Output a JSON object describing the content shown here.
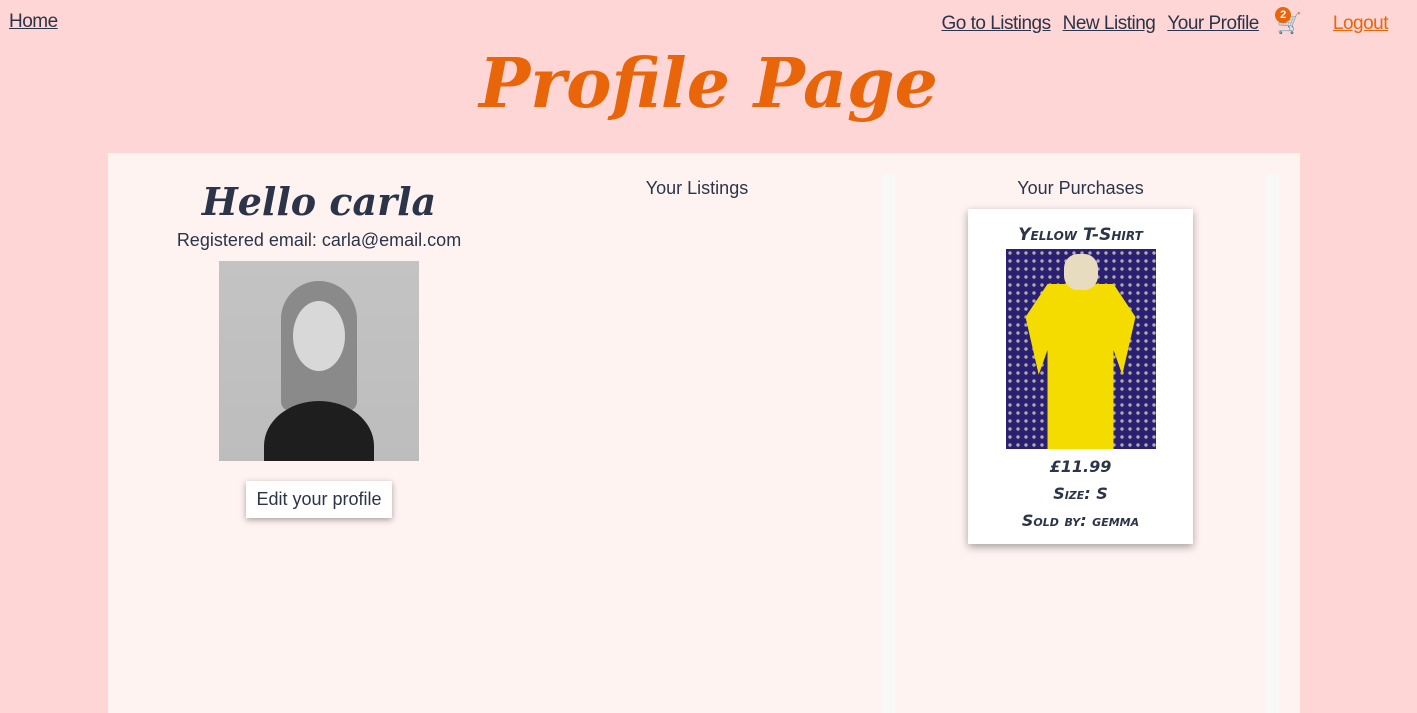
{
  "nav": {
    "home": "Home",
    "listings": "Go to Listings",
    "new_listing": "New Listing",
    "profile": "Your Profile",
    "cart_count": "2",
    "cart_icon": "shopping-cart-icon",
    "logout": "Logout"
  },
  "title": "Profile Page",
  "profile": {
    "greeting": "Hello carla",
    "email": "Registered email: carla@email.com",
    "edit_button": "Edit your profile"
  },
  "listings": {
    "heading": "Your Listings"
  },
  "purchases": {
    "heading": "Your Purchases",
    "items": [
      {
        "title": "Yellow T-Shirt",
        "price": "£11.99",
        "size": "Size: S",
        "seller": "Sold by: gemma"
      }
    ]
  },
  "colors": {
    "accent": "#e8650a",
    "background": "#ffd6d6",
    "panel": "#fff3f2",
    "text": "#2b3448"
  }
}
